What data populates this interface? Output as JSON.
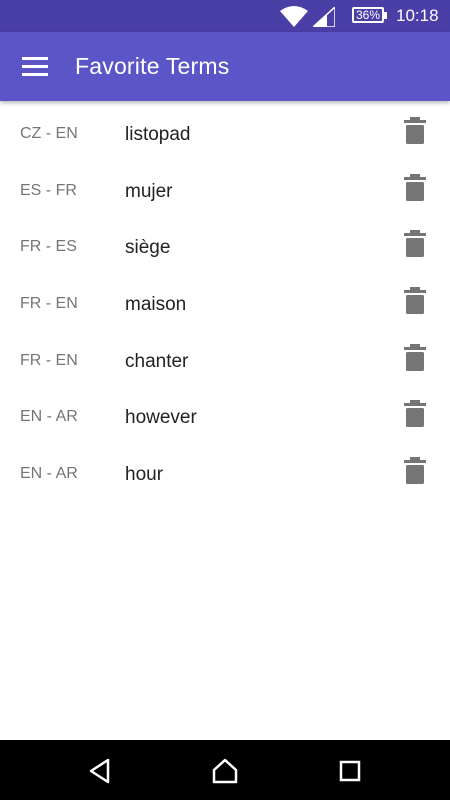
{
  "status_bar": {
    "battery": "36%",
    "time": "10:18",
    "icons": [
      "wifi-icon",
      "signal-icon",
      "battery-icon"
    ]
  },
  "app_bar": {
    "title": "Favorite Terms",
    "menu_icon": "hamburger-menu-icon"
  },
  "colors": {
    "status_bar": "#4a3fa7",
    "app_bar": "#5c55c7",
    "lang_text": "#757575",
    "word_text": "#222222",
    "delete_icon": "#757575"
  },
  "terms": [
    {
      "lang": "CZ - EN",
      "word": "listopad"
    },
    {
      "lang": "ES - FR",
      "word": "mujer"
    },
    {
      "lang": "FR - ES",
      "word": "siège"
    },
    {
      "lang": "FR - EN",
      "word": "maison"
    },
    {
      "lang": "FR - EN",
      "word": "chanter"
    },
    {
      "lang": "EN - AR",
      "word": "however"
    },
    {
      "lang": "EN - AR",
      "word": "hour"
    }
  ],
  "nav_bar": {
    "icons": [
      "back-icon",
      "home-icon",
      "recents-icon"
    ]
  }
}
